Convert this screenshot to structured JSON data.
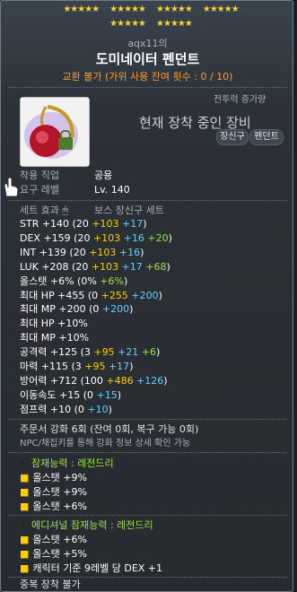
{
  "stars": {
    "row1_groups": [
      5,
      5,
      5,
      5
    ],
    "row2_groups": [
      5,
      5
    ]
  },
  "owner": "aqx11의",
  "item_name": "도미네이터 펜던트",
  "trade": "교환 불가 (가위 사용 잔여 횟수 : 0 / 10)",
  "combat_label": "전투력 증가량",
  "equipped_text": "현재 장착 중인 장비",
  "tags": [
    "장신구",
    "펜던트"
  ],
  "req": {
    "job_label": "착용 직업",
    "job_value": "공용",
    "level_label": "요구 레벨",
    "level_value": "Lv. 140"
  },
  "set_effect": {
    "label": "세트 효과",
    "value": "보스 장신구 세트"
  },
  "stats": [
    {
      "name": "STR",
      "parts": [
        {
          "t": "+140 (20 ",
          "c": "white"
        },
        {
          "t": "+103",
          "c": "yellow"
        },
        {
          "t": " +17",
          "c": "cyan"
        },
        {
          "t": ")",
          "c": "white"
        }
      ]
    },
    {
      "name": "DEX",
      "parts": [
        {
          "t": "+159 (20 ",
          "c": "white"
        },
        {
          "t": "+103",
          "c": "yellow"
        },
        {
          "t": " +16",
          "c": "cyan"
        },
        {
          "t": " +20",
          "c": "green"
        },
        {
          "t": ")",
          "c": "white"
        }
      ]
    },
    {
      "name": "INT",
      "parts": [
        {
          "t": "+139 (20 ",
          "c": "white"
        },
        {
          "t": "+103",
          "c": "yellow"
        },
        {
          "t": " +16",
          "c": "cyan"
        },
        {
          "t": ")",
          "c": "white"
        }
      ]
    },
    {
      "name": "LUK",
      "parts": [
        {
          "t": "+208 (20 ",
          "c": "white"
        },
        {
          "t": "+103",
          "c": "yellow"
        },
        {
          "t": " +17",
          "c": "cyan"
        },
        {
          "t": " +68",
          "c": "green"
        },
        {
          "t": ")",
          "c": "white"
        }
      ]
    },
    {
      "name": "올스탯",
      "parts": [
        {
          "t": "+6% (0% ",
          "c": "white"
        },
        {
          "t": "+6%",
          "c": "green"
        },
        {
          "t": ")",
          "c": "white"
        }
      ]
    },
    {
      "name": "최대 HP",
      "parts": [
        {
          "t": "+455 (0 ",
          "c": "white"
        },
        {
          "t": "+255",
          "c": "yellow"
        },
        {
          "t": " +200",
          "c": "cyan"
        },
        {
          "t": ")",
          "c": "white"
        }
      ]
    },
    {
      "name": "최대 MP",
      "parts": [
        {
          "t": "+200 (0 ",
          "c": "white"
        },
        {
          "t": "+200",
          "c": "cyan"
        },
        {
          "t": ")",
          "c": "white"
        }
      ]
    },
    {
      "name": "최대 HP",
      "parts": [
        {
          "t": "+10%",
          "c": "white"
        }
      ]
    },
    {
      "name": "최대 MP",
      "parts": [
        {
          "t": "+10%",
          "c": "white"
        }
      ]
    },
    {
      "name": "공격력",
      "parts": [
        {
          "t": "+125 (3 ",
          "c": "white"
        },
        {
          "t": "+95",
          "c": "yellow"
        },
        {
          "t": " +21",
          "c": "cyan"
        },
        {
          "t": " +6",
          "c": "green"
        },
        {
          "t": ")",
          "c": "white"
        }
      ]
    },
    {
      "name": "마력",
      "parts": [
        {
          "t": "+115 (3 ",
          "c": "white"
        },
        {
          "t": "+95",
          "c": "yellow"
        },
        {
          "t": " +17",
          "c": "cyan"
        },
        {
          "t": ")",
          "c": "white"
        }
      ]
    },
    {
      "name": "방어력",
      "parts": [
        {
          "t": "+712 (100 ",
          "c": "white"
        },
        {
          "t": "+486",
          "c": "yellow"
        },
        {
          "t": " +126",
          "c": "cyan"
        },
        {
          "t": ")",
          "c": "white"
        }
      ]
    },
    {
      "name": "이동속도",
      "parts": [
        {
          "t": "+15 (0 ",
          "c": "white"
        },
        {
          "t": "+15",
          "c": "cyan"
        },
        {
          "t": ")",
          "c": "white"
        }
      ]
    },
    {
      "name": "점프력",
      "parts": [
        {
          "t": "+10 (0 ",
          "c": "white"
        },
        {
          "t": "+10",
          "c": "cyan"
        },
        {
          "t": ")",
          "c": "white"
        }
      ]
    }
  ],
  "scroll_info": "주문서 강화 6회 (잔여 0회, 복구 가능 0회)",
  "npc_info": "NPC/채집키를 통해 강화 정보 상세 확인 가능",
  "potential": {
    "title": "잠재능력 : 레전드리",
    "badge": "L",
    "color": "#9fe04a",
    "lines": [
      "올스탯 +9%",
      "올스탯 +9%",
      "올스탯 +6%"
    ]
  },
  "additional": {
    "title": "에디셔널 잠재능력 : 레전드리",
    "badge": "L",
    "color": "#9fe04a",
    "lines": [
      "올스탯 +6%",
      "올스탯 +5%",
      "캐릭터 기준 9레벨 당 DEX +1"
    ]
  },
  "footer": "중복 장착 불가"
}
